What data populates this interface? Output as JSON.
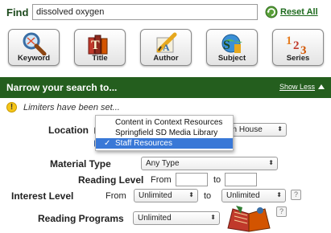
{
  "find": {
    "label": "Find",
    "query": "dissolved oxygen",
    "reset_label": "Reset All"
  },
  "search_types": [
    {
      "label": "Keyword",
      "icon": "magnifier-icon"
    },
    {
      "label": "Title",
      "icon": "books-icon"
    },
    {
      "label": "Author",
      "icon": "pencil-paper-icon"
    },
    {
      "label": "Subject",
      "icon": "subject-icon"
    },
    {
      "label": "Series",
      "icon": "numbers-icon"
    }
  ],
  "narrow": {
    "title": "Narrow your search to...",
    "show_less": "Show Less",
    "limiters_text": "Limiters have been set..."
  },
  "location": {
    "label": "Location",
    "selected_suffix": "tain House",
    "menu": [
      {
        "label": "Content in Context Resources",
        "checked": false
      },
      {
        "label": "Springfield SD Media Library",
        "checked": false
      },
      {
        "label": "Staff Resources",
        "checked": true
      }
    ],
    "check_glyph": "✓"
  },
  "material_type": {
    "label": "Material Type",
    "value": "Any Type"
  },
  "reading_level": {
    "label": "Reading Level",
    "from": "From",
    "to": "to"
  },
  "interest_level": {
    "label": "Interest Level",
    "from": "From",
    "from_value": "Unlimited",
    "to": "to",
    "to_value": "Unlimited",
    "help": "?"
  },
  "reading_programs": {
    "label": "Reading Programs",
    "value": "Unlimited",
    "help": "?"
  },
  "colors": {
    "header_green": "#245e1e",
    "menu_highlight": "#3978d7"
  }
}
